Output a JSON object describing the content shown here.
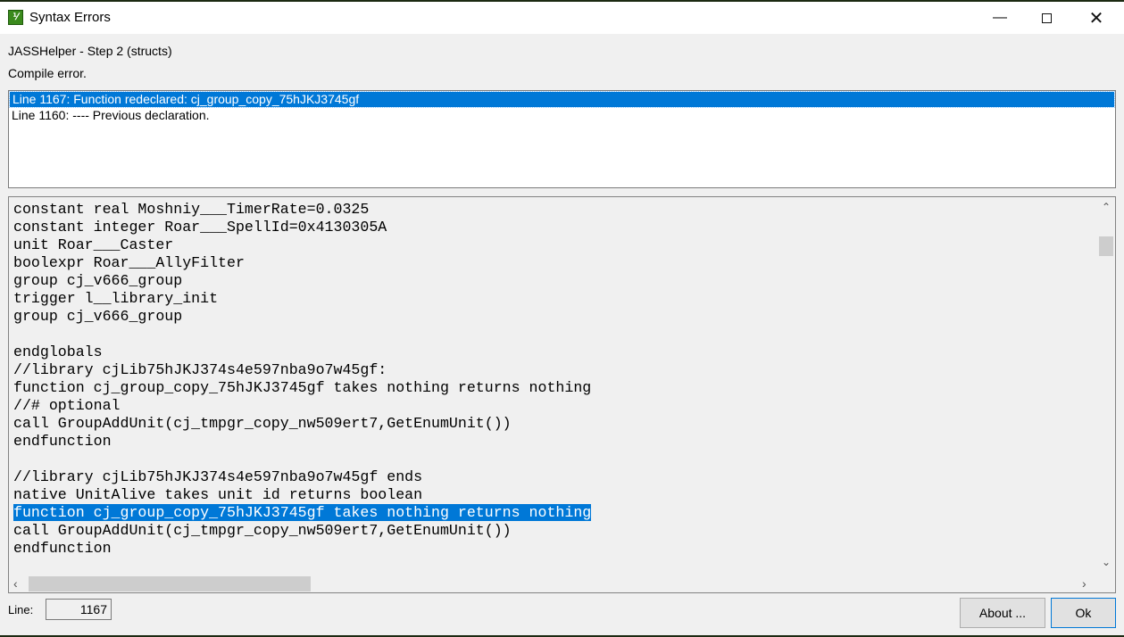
{
  "window": {
    "title": "Syntax Errors",
    "icon": "jasshelper-app-icon",
    "controls": [
      "minimize-icon",
      "maximize-icon",
      "close-icon"
    ]
  },
  "header": {
    "step": "JASSHelper - Step 2 (structs)",
    "status": "Compile error."
  },
  "errors": [
    {
      "text": "Line 1167: Function redeclared: cj_group_copy_75hJKJ3745gf",
      "selected": true
    },
    {
      "text": "Line 1160: ---- Previous declaration.",
      "selected": false
    }
  ],
  "code": {
    "lines": [
      "constant real Moshniy___TimerRate=0.0325",
      "constant integer Roar___SpellId=0x4130305A",
      "unit Roar___Caster",
      "boolexpr Roar___AllyFilter",
      "group cj_v666_group",
      "trigger l__library_init",
      "group cj_v666_group",
      "",
      "endglobals",
      "//library cjLib75hJKJ374s4e597nba9o7w45gf:",
      "function cj_group_copy_75hJKJ3745gf takes nothing returns nothing",
      "//# optional",
      "call GroupAddUnit(cj_tmpgr_copy_nw509ert7,GetEnumUnit())",
      "endfunction",
      "",
      "//library cjLib75hJKJ374s4e597nba9o7w45gf ends",
      "native UnitAlive takes unit id returns boolean",
      "function cj_group_copy_75hJKJ3745gf takes nothing returns nothing",
      "call GroupAddUnit(cj_tmpgr_copy_nw509ert7,GetEnumUnit())",
      "endfunction"
    ],
    "highlighted_index": 17
  },
  "footer": {
    "line_label": "Line:",
    "line_value": "1167",
    "about_label": "About ...",
    "ok_label": "Ok"
  },
  "colors": {
    "selection": "#0078d7"
  }
}
